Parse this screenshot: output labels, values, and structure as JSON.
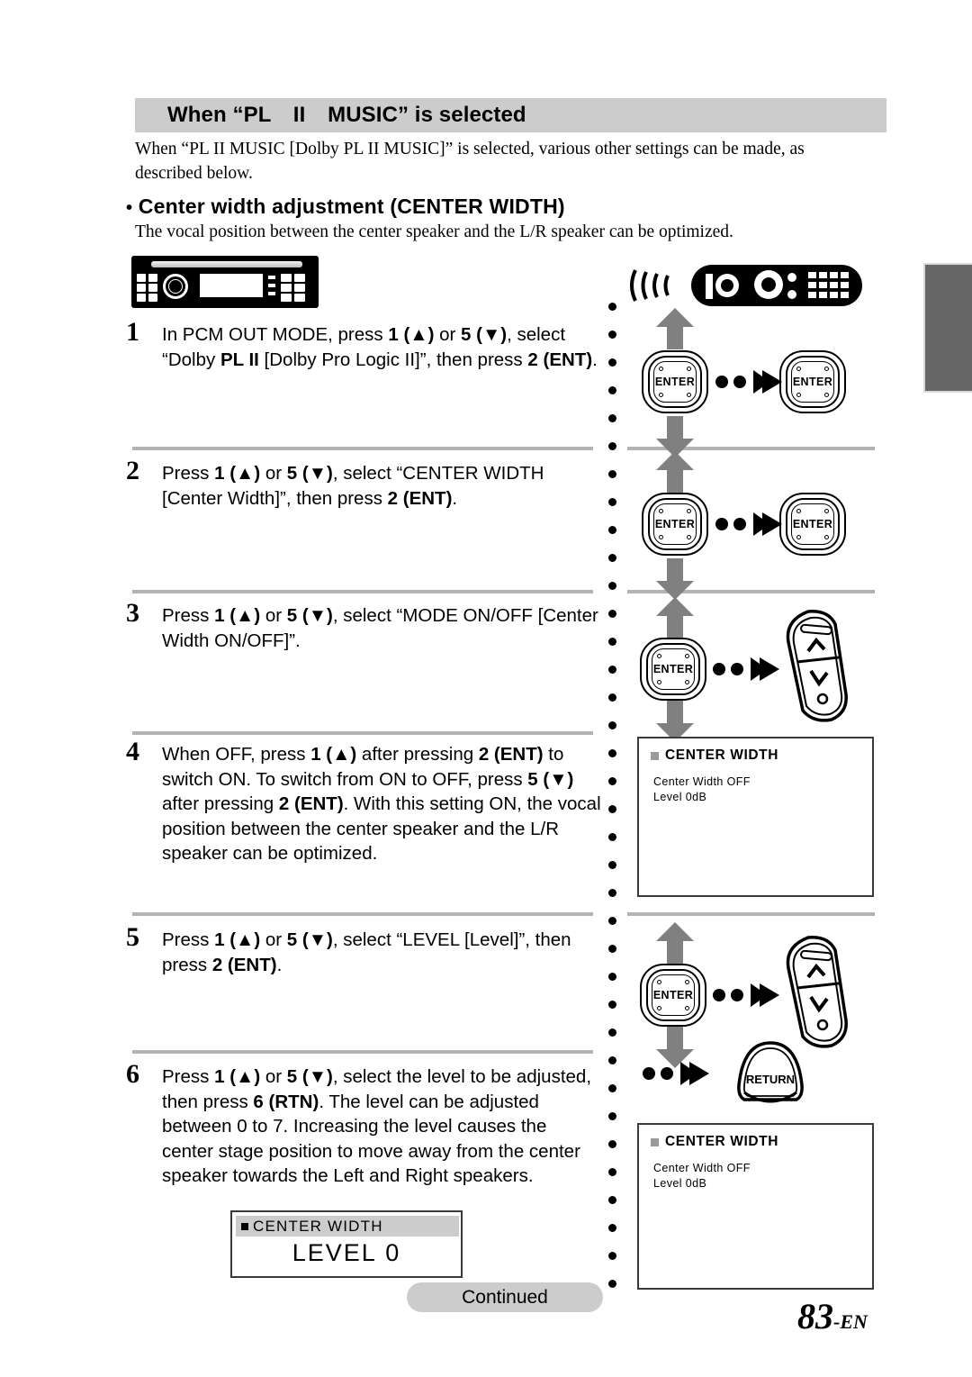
{
  "document": {
    "section_heading": "When “PL II MUSIC” is selected",
    "section_heading_pre": "When “PL ",
    "section_heading_sc": "II",
    "section_heading_post": " MUSIC” is selected",
    "intro_paragraph": "When “PL II MUSIC [Dolby PL II MUSIC]” is selected, various other settings can be made, as described below.",
    "bullet_heading": "Center width adjustment (CENTER WIDTH)",
    "bullet_marker": "•",
    "bullet_intro": "The vocal position between the center speaker and the L/R speaker can be optimized.",
    "continued_label": "Continued",
    "page_number": "83",
    "page_suffix": "-EN"
  },
  "steps": [
    {
      "number": "1",
      "text": "In PCM OUT MODE, press 1 (▲) or 5 (▼), select “Dolby PL II [Dolby Pro Logic II]”, then press 2 (ENT)."
    },
    {
      "number": "2",
      "text": "Press 1 (▲) or 5 (▼), select “CENTER WIDTH [Center Width]”, then press 2 (ENT)."
    },
    {
      "number": "3",
      "text": "Press 1 (▲) or 5 (▼), select “MODE ON/OFF [Center Width ON/OFF]”."
    },
    {
      "number": "4",
      "text": "When OFF, press 1 (▲) after pressing 2 (ENT) to switch ON. To switch from ON to OFF, press 5 (▼) after pressing 2 (ENT). With this setting ON, the vocal position between the center speaker and the L/R speaker can be optimized."
    },
    {
      "number": "5",
      "text": "Press 1 (▲) or 5 (▼), select “LEVEL [Level]”, then press 2 (ENT)."
    },
    {
      "number": "6",
      "text": "Press 1 (▲) or 5 (▼), select the level to be adjusted, then press 6 (RTN). The level can be adjusted between 0 to 7. Increasing the level causes the center stage position to move away from the center speaker towards the Left and Right speakers."
    }
  ],
  "buttons": {
    "enter_label": "ENTER",
    "return_label": "RETURN",
    "up_glyph": "∧",
    "down_glyph": "∨"
  },
  "screens": {
    "center_width_status_top": {
      "title": "CENTER  WIDTH",
      "line1": "Center  Width  OFF",
      "line2": "Level  0dB"
    },
    "center_width_status_bottom": {
      "title": "CENTER  WIDTH",
      "line1": "Center  Width  OFF",
      "line2": "Level  0dB"
    },
    "level_display": {
      "title": "CENTER WIDTH",
      "value_label": "LEVEL",
      "value": "0"
    }
  },
  "colors": {
    "heading_bar": "#cccccc",
    "separator": "#b3b3b3",
    "arrow_gray": "#808080",
    "edge_tab": "#666666",
    "screen_border": "#3a3a3a"
  }
}
